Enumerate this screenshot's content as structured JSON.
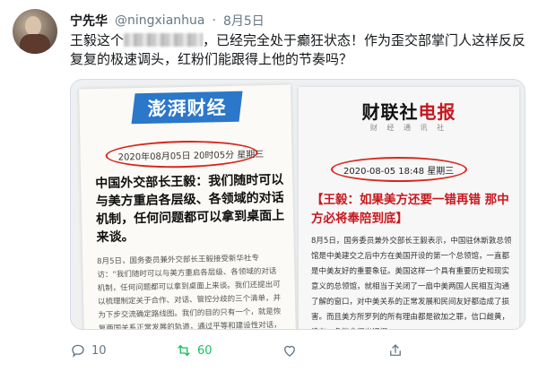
{
  "tweet": {
    "author_name": "宁先华",
    "handle": "@ningxianhua",
    "separator": "·",
    "date": "8月5日",
    "text_before": "王毅这个",
    "text_after": "，已经完全处于癫狂状态！作为歪交部掌门人这样反反复复的极速调头，红粉们能跟得上他的节奏吗？"
  },
  "media": {
    "left": {
      "logo": "澎湃财经",
      "timestamp": "2020年08月05日 20时05分 星期三",
      "headline": "中国外交部长王毅：我们随时可以与美方重启各层级、各领域的对话机制，任何问题都可以拿到桌面上来谈。",
      "body": "8月5日，国务委员兼外交部长王毅接受新华社专访：“我们随时可以与美方重启各层级、各领域的对话机制，任何问题都可以拿到桌面上来谈。我们还提出可以梳理制定关于合作、对话、管控分歧的三个清单，并为下步交流确定路线图。我们的目的只有一个，就是恢复两国关系正常发展的轨道，通过平等和建设性对话，缓解当前的紧张局面，回到不冲突不对抗的轨道上来。”"
    },
    "right": {
      "logo_prefix": "财联社",
      "logo_suffix": "电报",
      "subtitle": "财 经 通 讯 社",
      "timestamp": "2020-08-05 18:48 星期三",
      "headline": "【王毅：如果美方还要一错再错 那中方必将奉陪到底】",
      "body": "8月5日，国务委员兼外交部长王毅表示，中国驻休斯敦总领馆是中美建交之后中方在美国开设的第一个总领馆，一直都是中美友好的重要象征。美国这样一个具有重要历史和现实意义的总领馆，就相当于关闭了一扇中美两国人民相互沟通了解的窗口，对中美关系的正常发展和民间友好都造成了损害。而且美方所罗列的所有理由都是欲加之罪，信口雌黄，没有一条能拿得出证据。"
    }
  },
  "actions": {
    "reply_count": "10",
    "retweet_count": "60",
    "like_count": "",
    "share_label": ""
  },
  "colors": {
    "accent": "#1da1f2",
    "retweet": "#17bf63",
    "circle_highlight": "#d9261c"
  },
  "icons": [
    "reply-icon",
    "retweet-icon",
    "like-icon",
    "share-icon"
  ]
}
